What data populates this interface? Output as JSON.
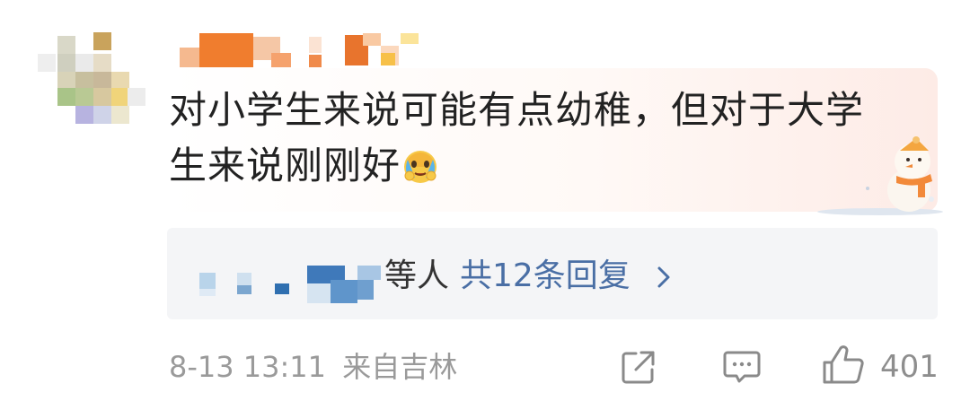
{
  "comment": {
    "text_line1": "对小学生来说可能有点幼稚，但对于大学",
    "text_line2": "生来说刚刚好",
    "emoji": "crying-face-emoji"
  },
  "replies": {
    "suffix": "等人",
    "link_label": "共12条回复",
    "chevron": "chevron-right-icon"
  },
  "footer": {
    "timestamp": "8-13 13:11",
    "location": "来自吉林",
    "share_icon": "share-icon",
    "comment_icon": "comment-icon",
    "like_icon": "thumbs-up-icon",
    "like_count": "401"
  },
  "colors": {
    "link": "#4a6fa5",
    "meta": "#9a9a9a",
    "text": "#222222",
    "card_bg": "#f4f5f7"
  }
}
